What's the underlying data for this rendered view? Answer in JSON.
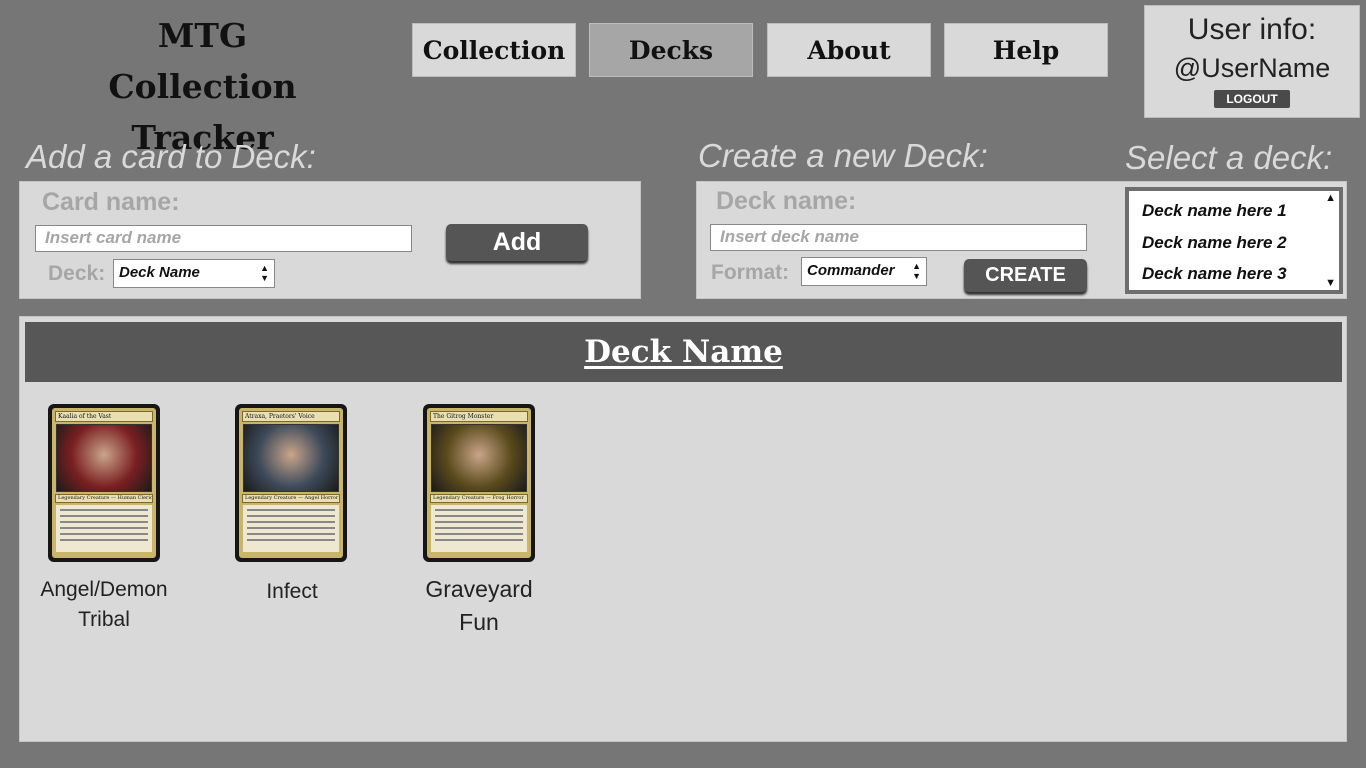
{
  "header": {
    "app_title": "MTG Collection Tracker",
    "nav": [
      {
        "label": "Collection",
        "active": false
      },
      {
        "label": "Decks",
        "active": true
      },
      {
        "label": "About",
        "active": false
      },
      {
        "label": "Help",
        "active": false
      }
    ],
    "user": {
      "label": "User info:",
      "username": "@UserName",
      "logout_label": "LOGOUT"
    }
  },
  "add_card": {
    "title": "Add a card to Deck:",
    "card_name_label": "Card name:",
    "card_name_placeholder": "Insert card name",
    "add_label": "Add",
    "deck_label": "Deck:",
    "deck_selected": "Deck Name"
  },
  "create_deck": {
    "title": "Create a new Deck:",
    "deck_name_label": "Deck name:",
    "deck_name_placeholder": "Insert deck name",
    "format_label": "Format:",
    "format_selected": "Commander",
    "create_label": "CREATE"
  },
  "select_deck": {
    "title": "Select a deck:",
    "items": [
      "Deck name here 1",
      "Deck name here 2",
      "Deck name here 3"
    ]
  },
  "deck_view": {
    "title": "Deck Name",
    "cards": [
      {
        "card_name": "Kaalia of the Vast",
        "type_line": "Legendary Creature — Human Cleric",
        "caption": "Angel/Demon Tribal",
        "art_color": "#7a1f22"
      },
      {
        "card_name": "Atraxa, Praetors' Voice",
        "type_line": "Legendary Creature — Angel Horror",
        "caption": "Infect",
        "art_color": "#3d4a5a"
      },
      {
        "card_name": "The Gitrog Monster",
        "type_line": "Legendary Creature — Frog Horror",
        "caption": "Graveyard Fun",
        "art_color": "#5a4a1c"
      }
    ]
  }
}
